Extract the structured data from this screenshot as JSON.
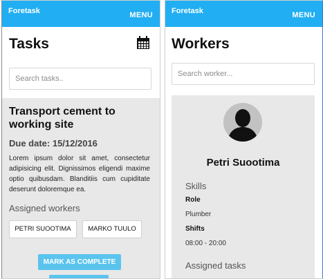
{
  "left": {
    "brand": "Foretask",
    "menu_label": "MENU",
    "page_title": "Tasks",
    "search_placeholder": "Search tasks..",
    "task": {
      "title": "Transport cement to working site",
      "due_date": "Due date: 15/12/2016",
      "description": "Lorem ipsum dolor sit amet, consectetur adipisicing elit. Dignissimos eligendi maxime optio quibusdam. Blanditiis cum cupiditate deserunt doloremque ea.",
      "assigned_heading": "Assigned workers",
      "workers": [
        "PETRI SUOOTIMA",
        "MARKO TUULO"
      ],
      "complete_label": "MARK AS COMPLETE"
    }
  },
  "right": {
    "brand": "Foretask",
    "menu_label": "MENU",
    "page_title": "Workers",
    "search_placeholder": "Search worker...",
    "worker": {
      "name": "Petri Suootima",
      "skills_heading": "Skills",
      "role_label": "Role",
      "role_value": "Plumber",
      "shifts_label": "Shifts",
      "shifts_value": "08:00 - 20:00",
      "assigned_heading": "Assigned tasks"
    }
  },
  "colors": {
    "appbar": "#21aef2",
    "card_bg": "#e8e8e8",
    "primary_button": "#5ac4ee"
  },
  "icons": [
    "calendar-icon",
    "avatar-silhouette-icon"
  ]
}
